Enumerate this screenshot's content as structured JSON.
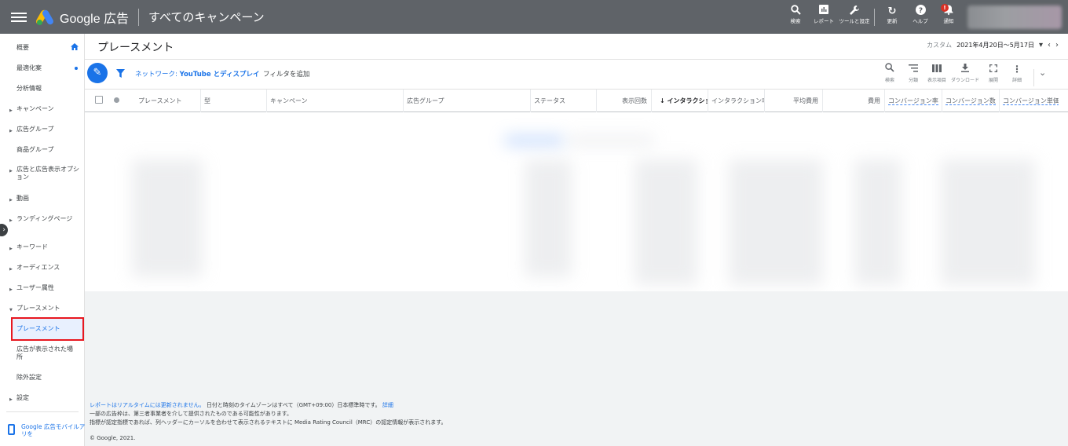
{
  "topbar": {
    "brand": "Google 広告",
    "page_title": "すべてのキャンペーン",
    "tools": {
      "search": "検索",
      "reports": "レポート",
      "tools_settings": "ツールと設定",
      "refresh": "更新",
      "help": "ヘルプ",
      "notifications": "通知",
      "notification_badge": "!"
    }
  },
  "sidebar": {
    "items": [
      {
        "label": "概要"
      },
      {
        "label": "最適化案"
      },
      {
        "label": "分析情報"
      },
      {
        "label": "キャンペーン"
      },
      {
        "label": "広告グループ"
      },
      {
        "label": "商品グループ"
      },
      {
        "label": "広告と広告表示オプション"
      },
      {
        "label": "動画"
      },
      {
        "label": "ランディングページ"
      },
      {
        "label": "キーワード"
      },
      {
        "label": "オーディエンス"
      },
      {
        "label": "ユーザー属性"
      },
      {
        "label": "プレースメント"
      },
      {
        "label": "プレースメント"
      },
      {
        "label": "広告が表示された場所"
      },
      {
        "label": "除外設定"
      },
      {
        "label": "設定"
      }
    ],
    "mobile_app": "Google 広告モバイルアプリを"
  },
  "header": {
    "title": "プレースメント",
    "date_label": "カスタム",
    "date_range": "2021年4月20日～5月17日"
  },
  "filter_bar": {
    "network_prefix": "ネットワーク: ",
    "network_value": "YouTube とディスプレイ",
    "add_filter": "フィルタを追加",
    "tools": {
      "search": "検索",
      "segment": "分類",
      "columns": "表示項目",
      "download": "ダウンロード",
      "expand": "展開",
      "more": "詳細"
    }
  },
  "table": {
    "columns": [
      "プレースメント",
      "型",
      "キャンペーン",
      "広告グループ",
      "ステータス",
      "表示回数",
      "↓ インタラクション",
      "インタラクション率",
      "平均費用",
      "費用",
      "コンバージョン率",
      "コンバージョン数",
      "コンバージョン単価"
    ]
  },
  "footer": {
    "line1_link": "レポートはリアルタイムには更新されません。",
    "line1_text": "日付と時刻のタイムゾーンはすべて（GMT+09:00）日本標準時です。",
    "line1_detail": "詳細",
    "line2": "一部の広告枠は、第三者事業者を介して提供されたものである可能性があります。",
    "line3": "指標が認定指標であれば、列ヘッダーにカーソルを合わせて表示されるテキストに Media Rating Council（MRC）の認定情報が表示されます。",
    "copyright": "© Google, 2021."
  }
}
